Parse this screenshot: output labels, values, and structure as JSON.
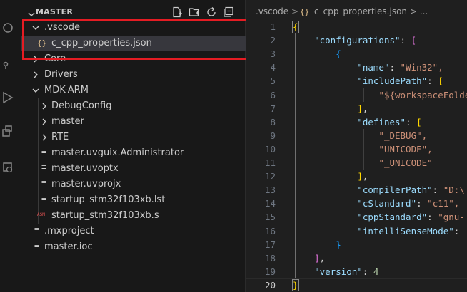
{
  "sidebar": {
    "folder_title": "MASTER",
    "items": [
      {
        "label": ".vscode",
        "kind": "folder-open"
      },
      {
        "label": "c_cpp_properties.json",
        "kind": "json",
        "icon_glyph": "{}"
      },
      {
        "label": "Core",
        "kind": "folder-closed"
      },
      {
        "label": "Drivers",
        "kind": "folder-closed"
      },
      {
        "label": "MDK-ARM",
        "kind": "folder-open"
      },
      {
        "label": "DebugConfig",
        "kind": "folder-closed"
      },
      {
        "label": "master",
        "kind": "folder-closed"
      },
      {
        "label": "RTE",
        "kind": "folder-closed"
      },
      {
        "label": "master.uvguix.Administrator",
        "kind": "file"
      },
      {
        "label": "master.uvoptx",
        "kind": "file"
      },
      {
        "label": "master.uvprojx",
        "kind": "file"
      },
      {
        "label": "startup_stm32f103xb.lst",
        "kind": "file"
      },
      {
        "label": "startup_stm32f103xb.s",
        "kind": "asm",
        "icon_glyph": "ASM"
      },
      {
        "label": ".mxproject",
        "kind": "file"
      },
      {
        "label": "master.ioc",
        "kind": "file"
      }
    ]
  },
  "editor": {
    "breadcrumb": {
      "folder": ".vscode",
      "separator": ">",
      "file_icon": "{}",
      "file": "c_cpp_properties.json",
      "trail": "> ..."
    },
    "line_numbers": [
      "1",
      "2",
      "3",
      "4",
      "5",
      "6",
      "7",
      "8",
      "9",
      "10",
      "11",
      "12",
      "13",
      "14",
      "15",
      "16",
      "17",
      "18",
      "19",
      "20"
    ],
    "code": {
      "open_brace": "{",
      "configurations_key": "\"configurations\"",
      "name_key": "\"name\"",
      "name_val": "\"Win32\",",
      "include_key": "\"includePath\"",
      "include_val": "\"${workspaceFolder",
      "defines_key": "\"defines\"",
      "def1": "\"_DEBUG\",",
      "def2": "\"UNICODE\",",
      "def3": "\"_UNICODE\"",
      "compiler_key": "\"compilerPath\"",
      "compiler_val": "\"D:\\",
      "cstd_key": "\"cStandard\"",
      "cstd_val": "\"c11\",",
      "cppstd_key": "\"cppStandard\"",
      "cppstd_val": "\"gnu-",
      "intelli_key": "\"intelliSenseMode\"",
      "version_key": "\"version\"",
      "version_val": "4",
      "close_brace": "}"
    }
  },
  "colors": {
    "highlight_box": "#e51c23",
    "selected_row": "#37373d"
  }
}
